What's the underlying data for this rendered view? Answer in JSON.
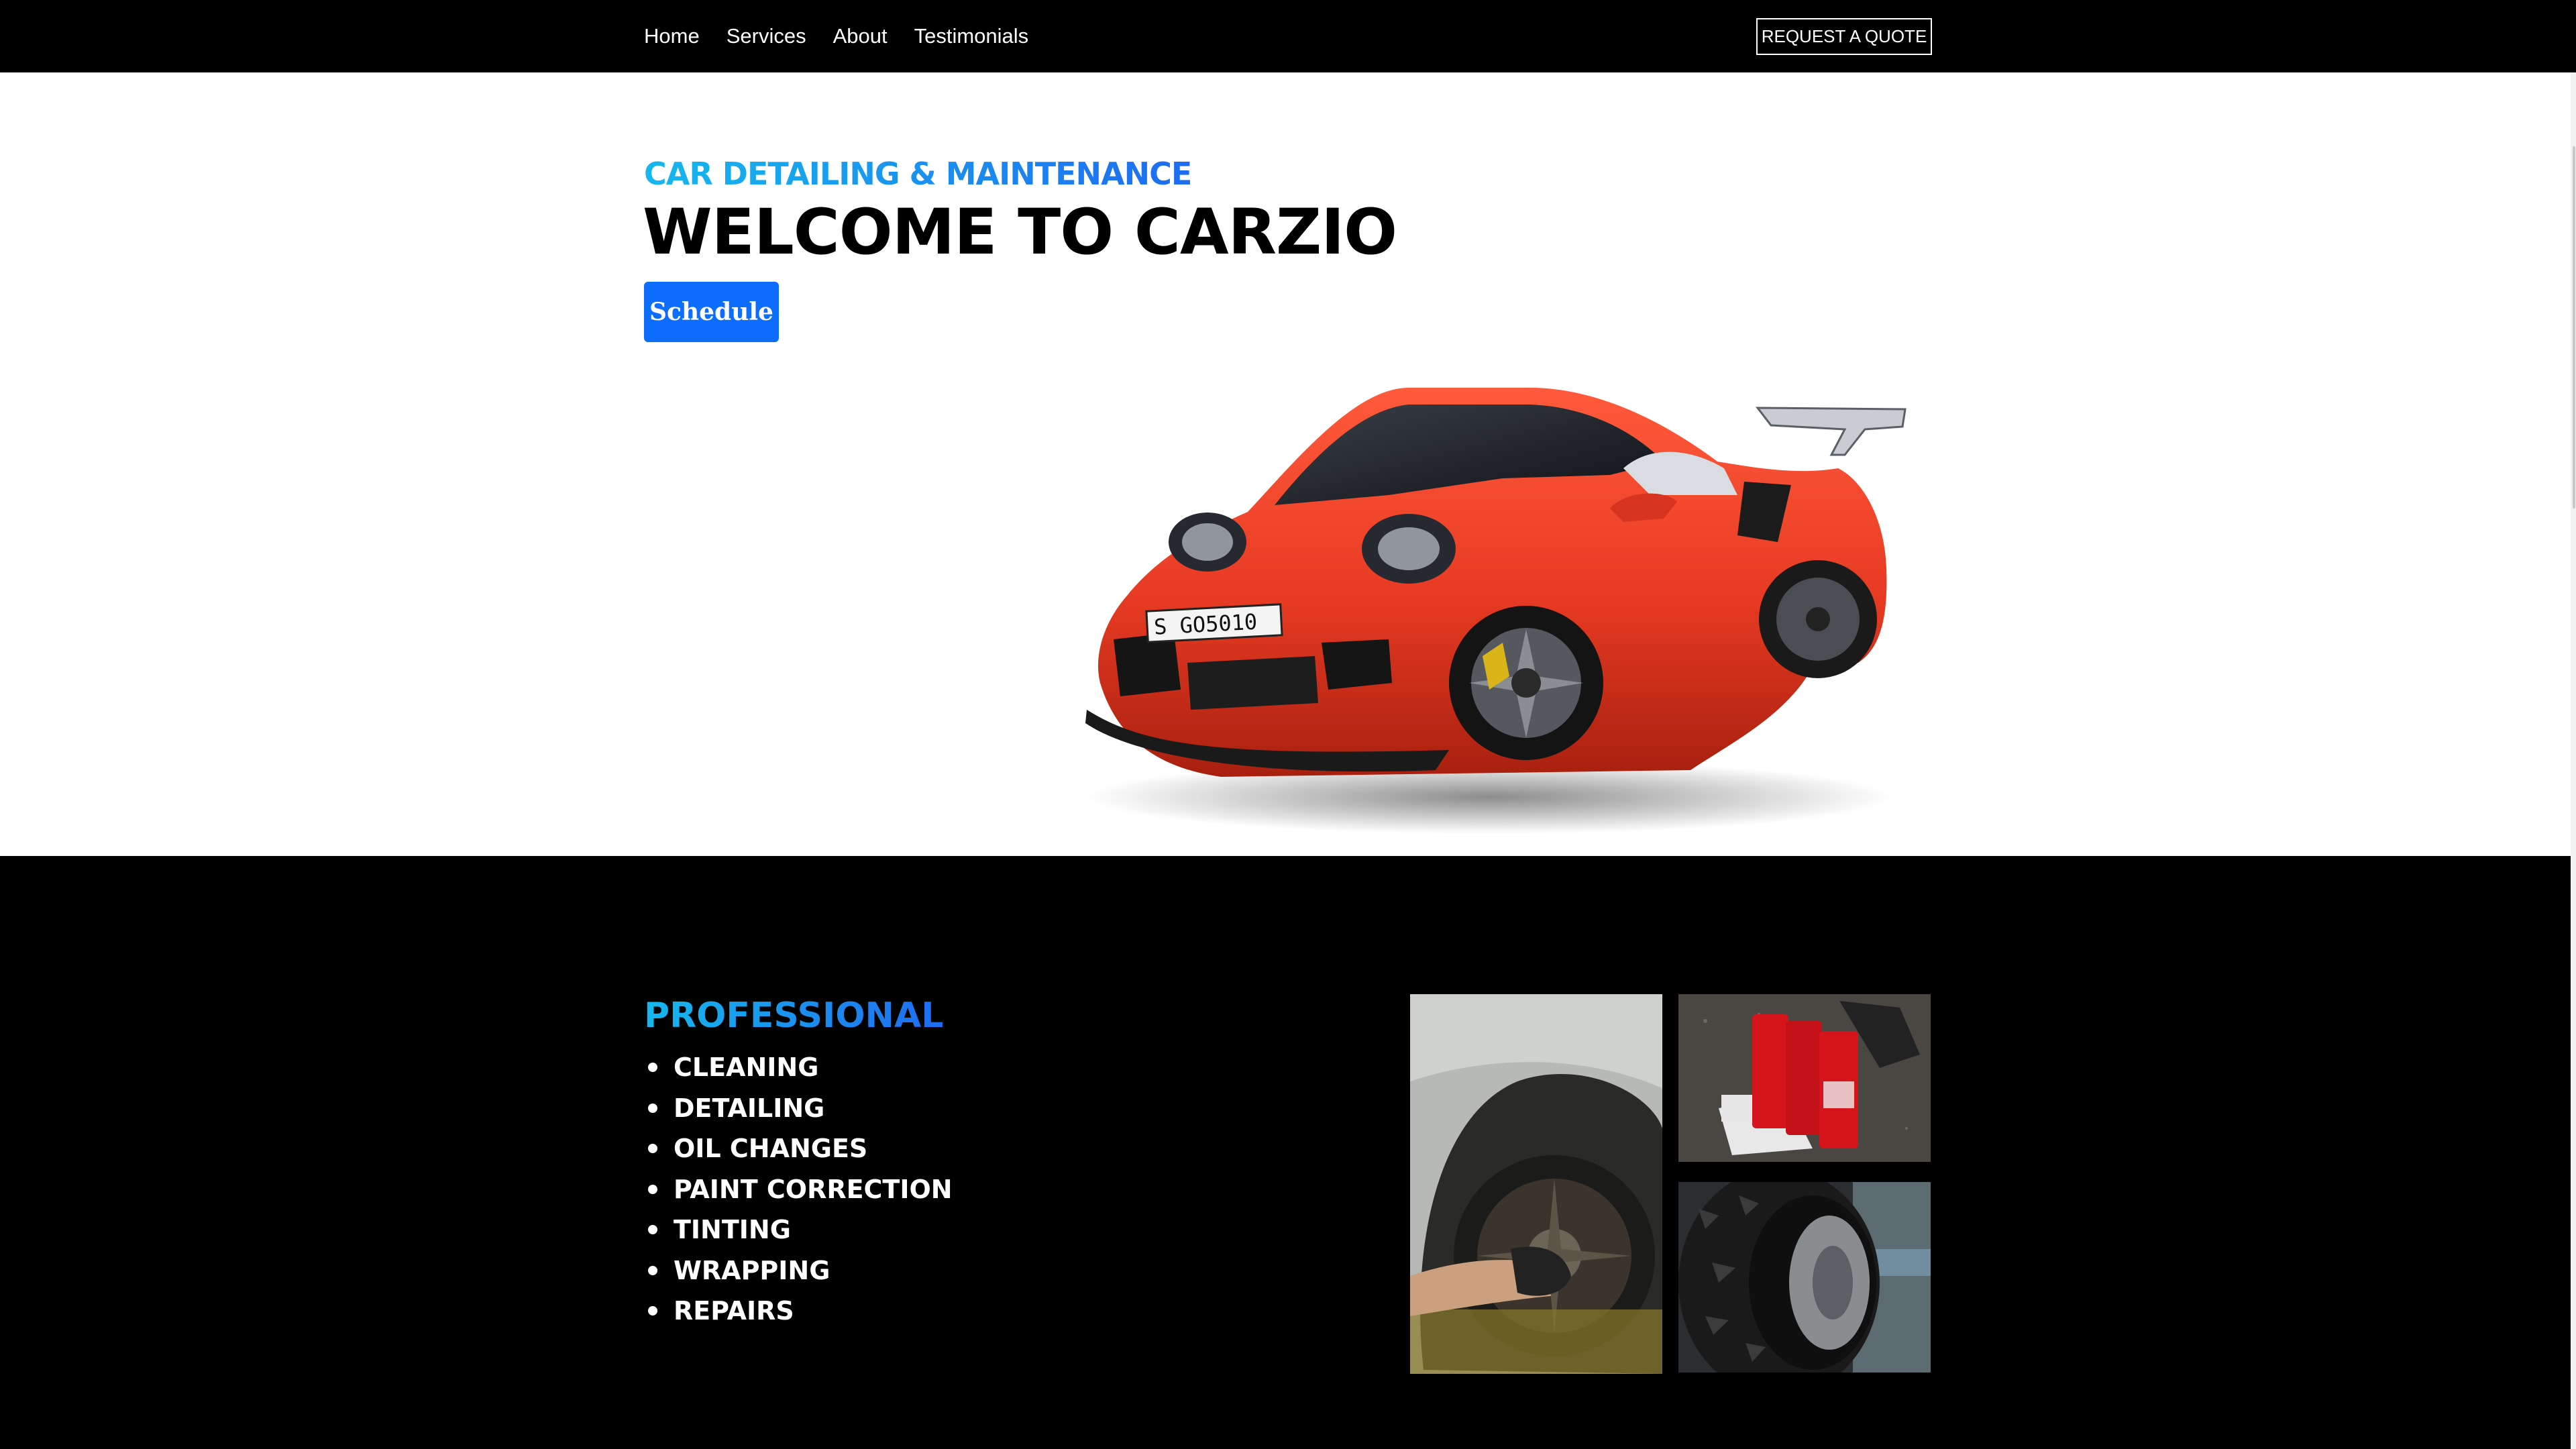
{
  "nav": {
    "links": [
      "Home",
      "Services",
      "About",
      "Testimonials"
    ],
    "quote_button": "REQUEST A QUOTE"
  },
  "hero": {
    "kicker": "CAR DETAILING & MAINTENANCE",
    "title": "WELCOME TO CARZIO",
    "schedule_button": "Schedule",
    "car_plate": "S GO5010",
    "car_color": "#e63a22"
  },
  "services": {
    "heading": "PROFESSIONAL",
    "items": [
      "CLEANING",
      "DETAILING",
      "OIL CHANGES",
      "PAINT CORRECTION",
      "TINTING",
      "WRAPPING",
      "REPAIRS"
    ]
  },
  "colors": {
    "accent_blue": "#0d6efd",
    "gradient_start": "#16b8ee",
    "gradient_end": "#1e6cf0"
  },
  "icons": [
    "car-image",
    "wheel-cleaning-photo",
    "motor-oil-photo",
    "tire-photo"
  ]
}
